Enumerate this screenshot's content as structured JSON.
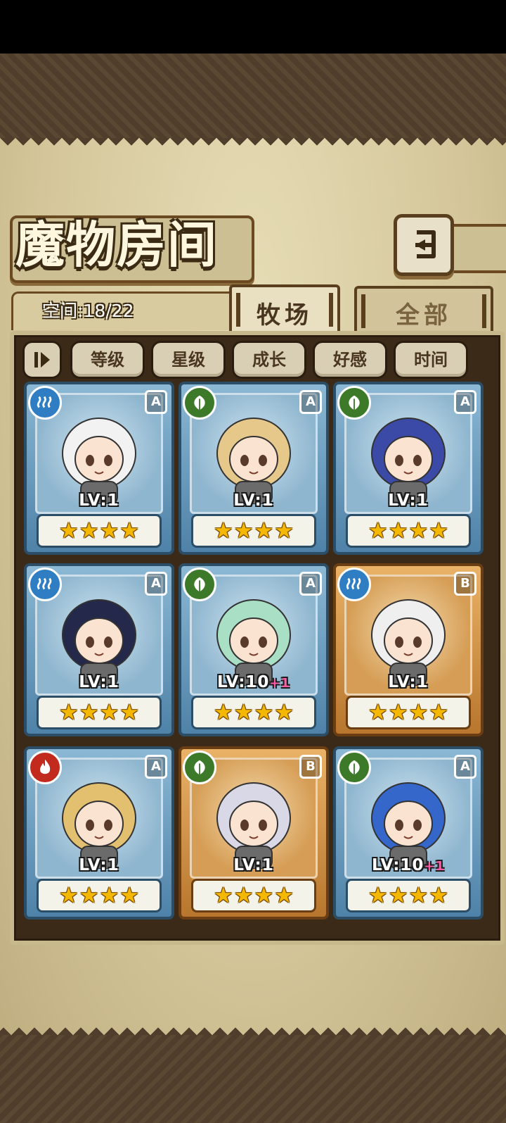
{
  "title": "魔物房间",
  "capacity": {
    "text": "空间:18/22"
  },
  "tabs": [
    {
      "label": "牧场",
      "active": true
    },
    {
      "label": "全部",
      "active": false
    }
  ],
  "sort_toggle_icon": "sort-order-icon",
  "filters": [
    "等级",
    "星级",
    "成长",
    "好感",
    "时间"
  ],
  "cards": [
    {
      "element": "water",
      "rank": "A",
      "level": "LV:1",
      "bonus": "",
      "stars": 4,
      "frame": "blue"
    },
    {
      "element": "wood",
      "rank": "A",
      "level": "LV:1",
      "bonus": "",
      "stars": 4,
      "frame": "blue"
    },
    {
      "element": "wood",
      "rank": "A",
      "level": "LV:1",
      "bonus": "",
      "stars": 4,
      "frame": "blue"
    },
    {
      "element": "water",
      "rank": "A",
      "level": "LV:1",
      "bonus": "",
      "stars": 4,
      "frame": "blue"
    },
    {
      "element": "wood",
      "rank": "A",
      "level": "LV:10",
      "bonus": "+1",
      "stars": 4,
      "frame": "blue"
    },
    {
      "element": "water",
      "rank": "B",
      "level": "LV:1",
      "bonus": "",
      "stars": 4,
      "frame": "gold"
    },
    {
      "element": "fire",
      "rank": "A",
      "level": "LV:1",
      "bonus": "",
      "stars": 4,
      "frame": "blue"
    },
    {
      "element": "wood",
      "rank": "B",
      "level": "LV:1",
      "bonus": "",
      "stars": 4,
      "frame": "gold"
    },
    {
      "element": "wood",
      "rank": "A",
      "level": "LV:10",
      "bonus": "+1",
      "stars": 4,
      "frame": "blue"
    }
  ],
  "star_glyph": "★",
  "colors": {
    "blue_frame": "#4f82a8",
    "gold_frame": "#b8762e",
    "star": "#f5b800",
    "level_bonus": "#ff5aa8"
  }
}
